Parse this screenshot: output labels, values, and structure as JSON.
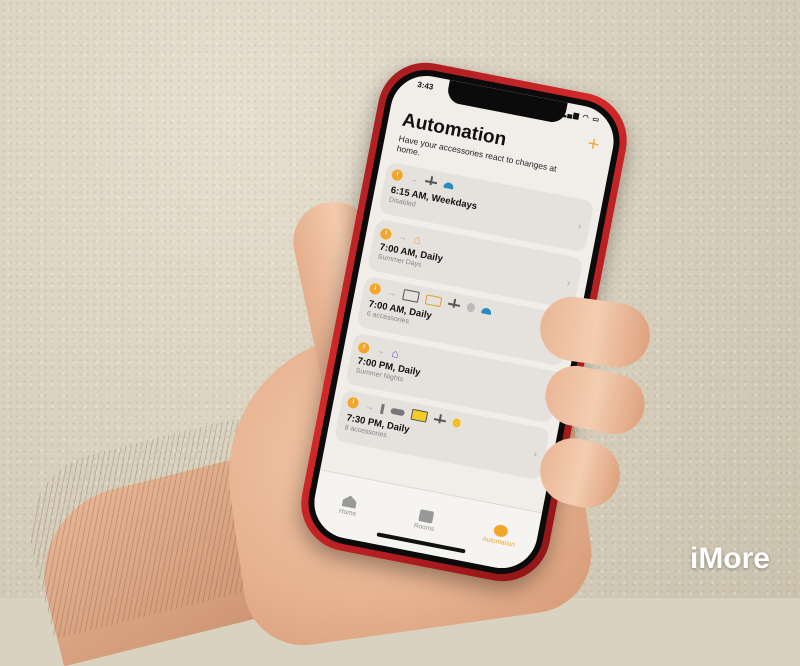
{
  "status_bar": {
    "time": "3:43",
    "icons": "▂▄▆ ◠ ▭"
  },
  "header": {
    "title": "Automation",
    "subtitle": "Have your accessories react to changes at home.",
    "add_icon": "plus-icon",
    "add_symbol": "+"
  },
  "automations": [
    {
      "title": "6:15 AM, Weekdays",
      "subtitle": "Disabled"
    },
    {
      "title": "7:00 AM, Daily",
      "subtitle": "Summer Days"
    },
    {
      "title": "7:00 AM, Daily",
      "subtitle": "6 accessories"
    },
    {
      "title": "7:00 PM, Daily",
      "subtitle": "Summer Nights"
    },
    {
      "title": "7:30 PM, Daily",
      "subtitle": "8 accessories"
    }
  ],
  "chevron": "›",
  "arrow": "→",
  "tabs": [
    {
      "label": "Home",
      "icon": "home-icon"
    },
    {
      "label": "Rooms",
      "icon": "rooms-icon"
    },
    {
      "label": "Automation",
      "icon": "automation-icon",
      "active": true
    }
  ],
  "colors": {
    "accent": "#f3a62a",
    "phone": "#d4282a"
  },
  "watermark": "iMore"
}
